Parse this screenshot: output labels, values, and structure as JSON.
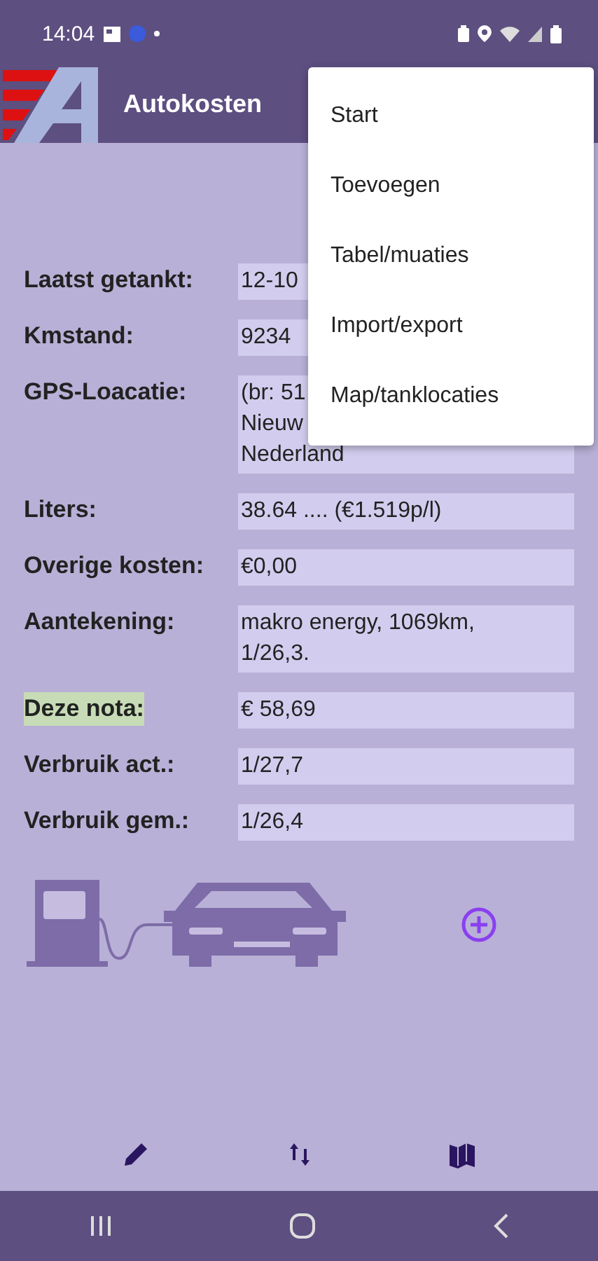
{
  "status_bar": {
    "time": "14:04"
  },
  "app_bar": {
    "title": "Autokosten"
  },
  "menu": {
    "items": [
      "Start",
      "Toevoegen",
      "Tabel/muaties",
      "Import/export",
      "Map/tanklocaties"
    ]
  },
  "fields": [
    {
      "label": "Laatst getankt:",
      "lines": [
        "12-10"
      ],
      "highlighted": false
    },
    {
      "label": "Kmstand:",
      "lines": [
        "9234"
      ],
      "highlighted": false
    },
    {
      "label": "GPS-Loacatie:",
      "lines": [
        "(br: 51",
        "Nieuw",
        "Nederland"
      ],
      "highlighted": false
    },
    {
      "label": "Liters:",
      "lines": [
        "38.64 .... (€1.519p/l)"
      ],
      "highlighted": false
    },
    {
      "label": "Overige kosten:",
      "lines": [
        "€0,00"
      ],
      "highlighted": false
    },
    {
      "label": "Aantekening:",
      "lines": [
        "makro energy, 1069km,",
        "1/26,3."
      ],
      "highlighted": false
    },
    {
      "label": "Deze nota:",
      "lines": [
        "€ 58,69"
      ],
      "highlighted": true
    },
    {
      "label": "Verbruik act.:",
      "lines": [
        "1/27,7"
      ],
      "highlighted": false
    },
    {
      "label": "Verbruik gem.:",
      "lines": [
        "1/26,4"
      ],
      "highlighted": false
    }
  ]
}
